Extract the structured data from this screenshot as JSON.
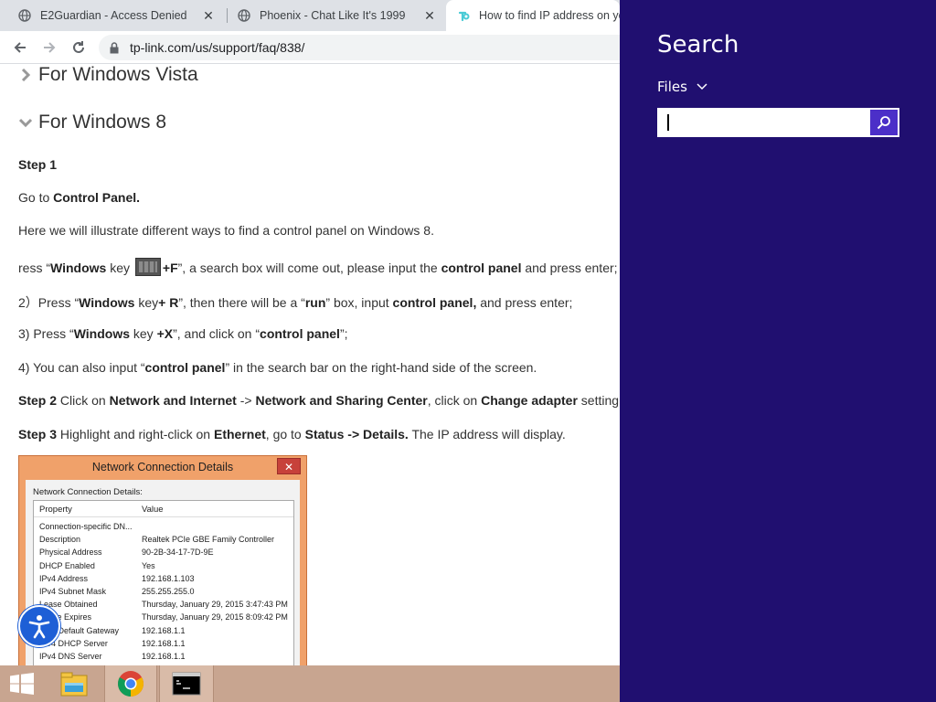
{
  "browser": {
    "tabs": [
      {
        "title": "E2Guardian - Access Denied",
        "icon": "globe-icon"
      },
      {
        "title": "Phoenix - Chat Like It's 1999",
        "icon": "globe-icon"
      },
      {
        "title": "How to find IP address on you",
        "icon": "tplink-icon"
      }
    ],
    "url": "tp-link.com/us/support/faq/838/"
  },
  "page": {
    "headings": [
      "For Windows Vista",
      "For Windows 8"
    ],
    "step1_label": "Step 1",
    "goto_prefix": "Go to ",
    "goto_bold": "Control Panel.",
    "intro": "Here we will illustrate different ways to find a control panel on Windows 8.",
    "l1": {
      "a": "ress “",
      "b": "Windows",
      "c": " key ",
      "d": "+F",
      "e": "”, a search box will come out, please input the ",
      "f": "control panel",
      "g": " and press enter;"
    },
    "l2": {
      "a": "2）Press “",
      "b": "Windows",
      "c": " key",
      "d": "+ R",
      "e": "”, then there will be a “",
      "f": "run",
      "g": "” box, input ",
      "h": "control panel,",
      "i": " and press enter;"
    },
    "l3": {
      "a": "3) Press “",
      "b": "Windows",
      "c": " key ",
      "d": "+X",
      "e": "”, and click on “",
      "f": "control panel",
      "g": "”;"
    },
    "l4": {
      "a": "4) You can also input “",
      "b": "control panel",
      "c": "” in the search bar on the right-hand side of the screen."
    },
    "step2": {
      "a": "Step 2",
      "b": " Click on ",
      "c": "Network and Internet",
      "d": " -> ",
      "e": "Network and Sharing Center",
      "f": ", click on ",
      "g": "Change adapter",
      "h": " setting"
    },
    "step3": {
      "a": "Step 3",
      "b": " Highlight and right-click on ",
      "c": "Ethernet",
      "d": ", go to ",
      "e": "Status -> Details.",
      "f": " The IP address will display."
    }
  },
  "dialog": {
    "title": "Network Connection Details",
    "close": "✕",
    "caption": "Network Connection Details:",
    "col_property": "Property",
    "col_value": "Value",
    "rows": [
      {
        "p": "Connection-specific DN...",
        "v": ""
      },
      {
        "p": "Description",
        "v": "Realtek PCIe GBE Family Controller"
      },
      {
        "p": "Physical Address",
        "v": "90-2B-34-17-7D-9E"
      },
      {
        "p": "DHCP Enabled",
        "v": "Yes"
      },
      {
        "p": "IPv4 Address",
        "v": "192.168.1.103"
      },
      {
        "p": "IPv4 Subnet Mask",
        "v": "255.255.255.0"
      },
      {
        "p": "Lease Obtained",
        "v": "Thursday, January 29, 2015 3:47:43 PM"
      },
      {
        "p": "Lease Expires",
        "v": "Thursday, January 29, 2015 8:09:42 PM"
      },
      {
        "p": "IPv4 Default Gateway",
        "v": "192.168.1.1"
      },
      {
        "p": "IPv4 DHCP Server",
        "v": "192.168.1.1"
      },
      {
        "p": "IPv4 DNS Server",
        "v": "192.168.1.1"
      }
    ]
  },
  "taskbar": {
    "items": [
      "windows-start-icon",
      "file-explorer-icon",
      "chrome-icon",
      "command-prompt-icon"
    ]
  },
  "charm": {
    "title": "Search",
    "scope": "Files",
    "input_value": ""
  },
  "colors": {
    "charm_bg": "#200f70",
    "search_button": "#4b2fc8",
    "taskbar": "#c8a590",
    "dialog_frame": "#f0a16a"
  }
}
